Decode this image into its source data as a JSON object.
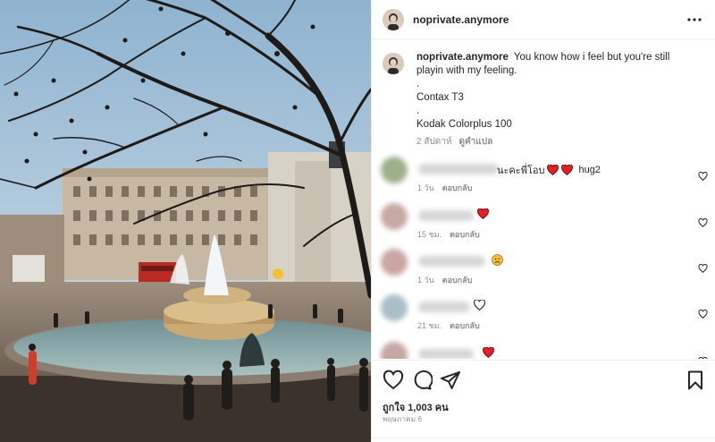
{
  "post": {
    "username": "noprivate.anymore",
    "caption": {
      "username": "noprivate.anymore",
      "text": "You know how i feel but you're still playin with my feeling.",
      "lines": [
        ".",
        "Contax T3",
        ".",
        "Kodak Colorplus 100"
      ],
      "time": "2 สัปดาห์",
      "translate_label": "ดูคำแปล"
    },
    "comments": [
      {
        "text": "นะคะพี่โอบ",
        "emojis": [
          "heart",
          "heart"
        ],
        "suffix": "hug2",
        "time": "1 วัน",
        "reply": "ตอบกลับ"
      },
      {
        "text": "",
        "emojis": [
          "heart"
        ],
        "suffix": "",
        "time": "15 ชม.",
        "reply": "ตอบกลับ"
      },
      {
        "text": "",
        "emojis": [
          "sad-face"
        ],
        "suffix": "",
        "time": "1 วัน",
        "reply": "ตอบกลับ"
      },
      {
        "text": "",
        "emojis": [
          "white-heart"
        ],
        "suffix": "",
        "time": "21 ชม.",
        "reply": "ตอบกลับ"
      },
      {
        "text": "",
        "emojis": [
          "heart"
        ],
        "suffix": "",
        "time": "",
        "reply": ""
      }
    ],
    "likes_text": "ถูกใจ 1,003 คน",
    "date": "พฤษภาคม 6"
  },
  "colors": {
    "heart_red": "#ed1c24",
    "muted_text": "#8e8e8e",
    "text": "#262626",
    "divider": "#efefef"
  },
  "icons": [
    "more-options-icon",
    "like-icon",
    "comment-icon",
    "share-icon",
    "save-icon"
  ]
}
